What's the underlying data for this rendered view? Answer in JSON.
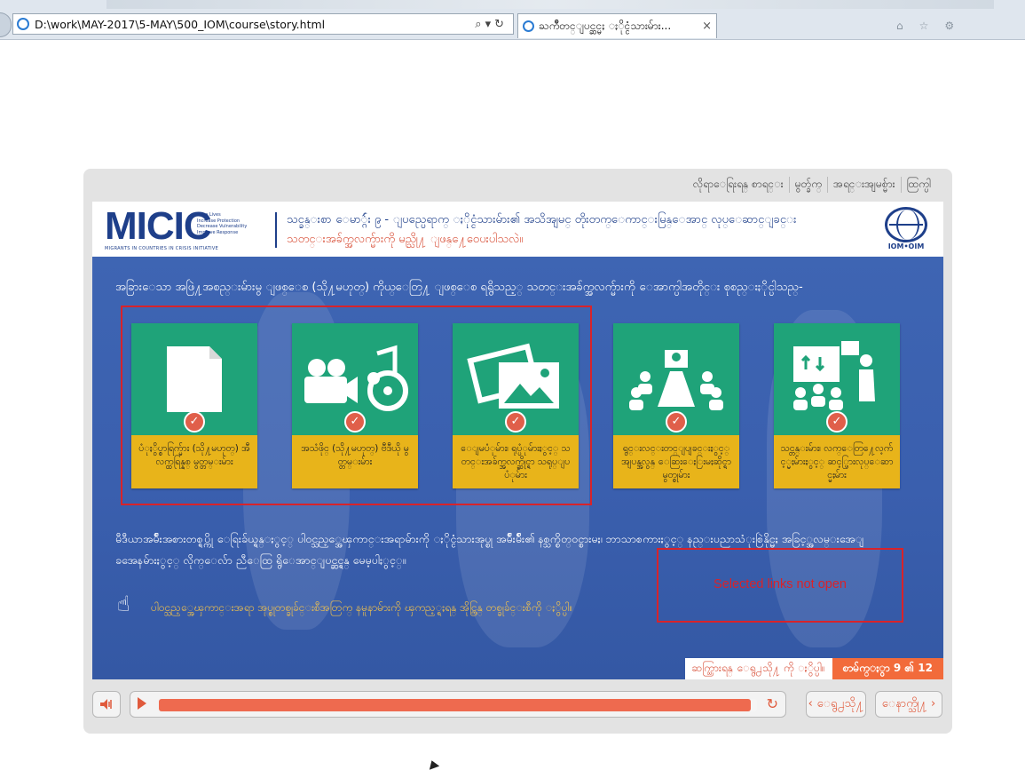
{
  "browser": {
    "address": "D:\\work\\MAY-2017\\5-MAY\\500_IOM\\course\\story.html",
    "tab_title": "ႀကိဳတင္ျပင္ဆင္မႈ ႏိုင္ငံသားမ်ား...",
    "close_glyph": "×"
  },
  "player": {
    "top_links": [
      "လိုရာေရြးရန္ စာရင္း",
      "မွတ္ခ်က္",
      "အရင္းအျမစ္မ်ား",
      "ထြက္ပါ"
    ],
    "header": {
      "logo_text": "MICIC",
      "logo_tagline": "Save Lives\nIncrease Protection\nDecrease Vulnerability\nImprove Response",
      "logo_sub": "MIGRANTS IN COUNTRIES IN CRISIS INITIATIVE",
      "title": "သင္ခန္းစာ ေမာ္ဂ်ဴး ၉ - ျပည္ပေရာက္ ႏိုင္ငံသားမ်ား၏ အသိအျမင္ တိုးတက္ေကာင္းမြန္ေအာင္ လုပ္ေဆာင္ျခင္း",
      "subtitle": "သတင္းအခ်က္အလက္မ်ားကို မည္သို႔ ျဖန္႔ေဝေပးပါသလဲ။",
      "iom_label": "IOM•OIM"
    },
    "intro": "အခြားေသာ အဖြဲ႔အစည္းမ်ားမွ ျဖစ္ေစ (သို႔မဟုတ္) ကိုယ္ေတြ႔ ျဖစ္ေစ ရရွိသည့္ သတင္းအခ်က္အလက္မ်ားကို ေအာက္ပါအတိုင္း စုစည္းႏိုင္ပါသည္-",
    "cards": [
      {
        "label": "ပံုႏွိပ္စာရြက္မ်ား (သို႔မဟုတ္) အီလက္ထရြန္နစ္ မွတ္တမ္းမ်ား",
        "icon": "document-icon",
        "checked": true
      },
      {
        "label": "အသံဖိုင္ (သို႔မဟုတ္) ဗီဒီယို မွတ္တမ္းမ်ား",
        "icon": "video-audio-icon",
        "checked": true
      },
      {
        "label": "ေျမပံုမ်ား၊ ရုပ္ပံုမ်ားႏွင့္ သတင္းအခ်က္အလက္ဆိုင္ရာ သရုပ္ျပပံုမ်ား",
        "icon": "images-icon",
        "checked": true
      },
      {
        "label": "ရွင္းလင္းတင္ျပျခင္းႏွင့္ အျပန္အလွန္ ေဆြးေႏြးမႈဆိုင္ရာ မွတ္စုမ်ား",
        "icon": "meeting-icon",
        "checked": true
      },
      {
        "label": "သင္တန္းမ်ား၊ လက္ေတြ႔ေလ့က်င့္မႈမ်ားႏွင့္ ဆင့္ပြားလုပ္ေဆာင္မႈမ်ား",
        "icon": "presentation-icon",
        "checked": true
      }
    ],
    "paragraph": "မီဒီယာအမ်ိဳးအစားတစ္ရပ္ကို ေရြးခ်ယ္ရန္ႏွင့္ ပါဝင္သည့္အေၾကာင္းအရာမ်ားကို ႏိုင္ငံသားအုပ္စု အမ်ိဳးမ်ိဳး၏ နစ္သက္စိတ္ဝင္စားမႈ၊ ဘာသာစကားႏွင့္ နည္းပညာသံုးစြဲနိုင္မႈ အခြင့္အလမ္းအေျခအေနမ်ားႏွင့္ လိုက္ေလ်ာ ညီေထြ ရွိေအာင္ျပင္ဆင္ရန္ မေမ့ပါႏွင့္။",
    "hint": "ပါဝင္သည့္အေၾကာင္းအရာ အုပ္စုတစ္ခုခ်င္းစီအတြက္ နမူနာမ်ားကို ၾကည့္ရႈရန္ အိုင္ကြန္ တစ္ခုခ်င္းစီကို ႏွိပ္ပါ။",
    "annotation": "Selected links not open",
    "footer": {
      "next_hint": "ဆက္သြားရန္ ေရွ႕သို႔ ကို ႏွိပ္ပါ။",
      "page_label": "စာမ်က္ႏွာ 9 ၏ 12"
    },
    "controls": {
      "progress": 0.99,
      "prev_label": "‹ ေရွ႕သို႔",
      "next_label": "ေနာက္သို႔ ›"
    },
    "colors": {
      "card_green": "#1fa379",
      "card_gold": "#e8b41a",
      "accent": "#f26b3b",
      "annotation_red": "#d8232a"
    }
  }
}
